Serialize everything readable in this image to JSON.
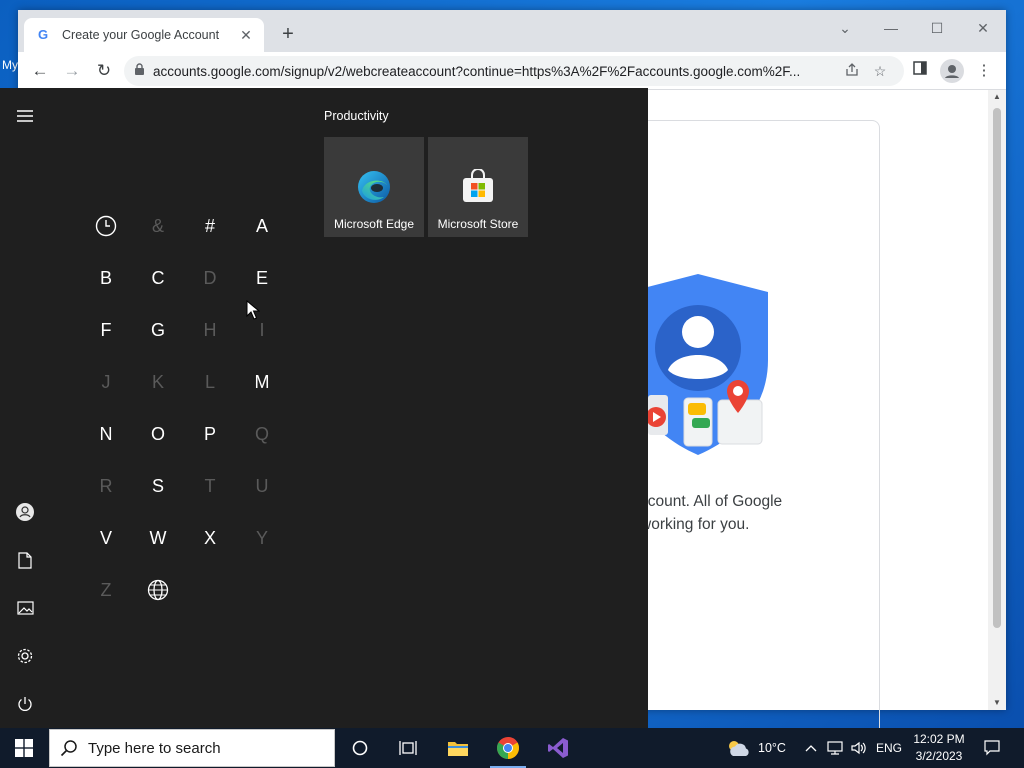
{
  "desktop": {
    "label": "My"
  },
  "browser": {
    "tab": {
      "title": "Create your Google Account",
      "favicon": "G",
      "close": "✕"
    },
    "new_tab": "+",
    "window_controls": {
      "tab_search": "⌄",
      "minimize": "—",
      "maximize": "☐",
      "close": "✕"
    },
    "nav": {
      "back": "←",
      "forward": "→",
      "reload": "↻"
    },
    "url": "accounts.google.com/signup/v2/webcreateaccount?continue=https%3A%2F%2Faccounts.google.com%2F..."
  },
  "page": {
    "card_text_line1": "ccount. All of Google",
    "card_text_line2": "working for you."
  },
  "start_menu": {
    "letters": [
      {
        "char": "&",
        "dim": true
      },
      {
        "char": "#",
        "dim": false
      },
      {
        "char": "A",
        "dim": false
      },
      {
        "char": "B",
        "dim": false
      },
      {
        "char": "C",
        "dim": false
      },
      {
        "char": "D",
        "dim": true
      },
      {
        "char": "E",
        "dim": false
      },
      {
        "char": "F",
        "dim": false
      },
      {
        "char": "G",
        "dim": false
      },
      {
        "char": "H",
        "dim": true
      },
      {
        "char": "I",
        "dim": true
      },
      {
        "char": "J",
        "dim": true
      },
      {
        "char": "K",
        "dim": true
      },
      {
        "char": "L",
        "dim": true
      },
      {
        "char": "M",
        "dim": false
      },
      {
        "char": "N",
        "dim": false
      },
      {
        "char": "O",
        "dim": false
      },
      {
        "char": "P",
        "dim": false
      },
      {
        "char": "Q",
        "dim": true
      },
      {
        "char": "R",
        "dim": true
      },
      {
        "char": "S",
        "dim": false
      },
      {
        "char": "T",
        "dim": true
      },
      {
        "char": "U",
        "dim": true
      },
      {
        "char": "V",
        "dim": false
      },
      {
        "char": "W",
        "dim": false
      },
      {
        "char": "X",
        "dim": false
      },
      {
        "char": "Y",
        "dim": true
      },
      {
        "char": "Z",
        "dim": true
      }
    ],
    "group_title": "Productivity",
    "tiles": [
      {
        "label": "Microsoft Edge",
        "icon": "edge-icon"
      },
      {
        "label": "Microsoft Store",
        "icon": "store-icon"
      }
    ]
  },
  "taskbar": {
    "search_placeholder": "Type here to search",
    "weather": "10°C",
    "language": "ENG",
    "time": "12:02 PM",
    "date": "3/2/2023"
  },
  "colors": {
    "start_bg": "#1f1f1f",
    "tile_bg": "#3a3a3a",
    "taskbar_bg": "#101b2b",
    "google_blue": "#4285f4"
  }
}
